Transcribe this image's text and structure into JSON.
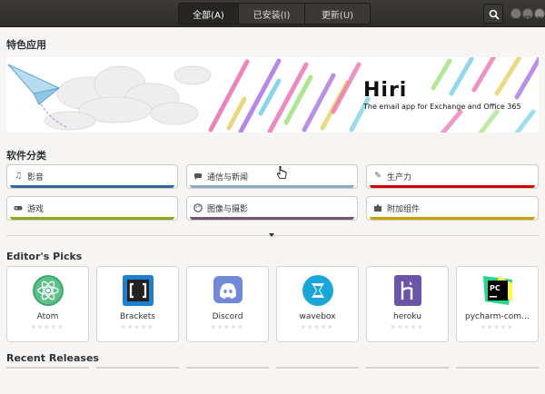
{
  "tabs": [
    {
      "label": "全部(A)",
      "active": true
    },
    {
      "label": "已安装(I)",
      "active": false
    },
    {
      "label": "更新(U)",
      "active": false
    }
  ],
  "featured": {
    "title": "特色应用",
    "app_name": "Hiri",
    "tagline": "The email app for Exchange and Office 365"
  },
  "categories": {
    "title": "软件分类",
    "items": [
      {
        "label": "影音",
        "icon": "music-note-icon",
        "color": "#3465a4"
      },
      {
        "label": "通信与新闻",
        "icon": "chat-bubble-icon",
        "color": "#88aacc"
      },
      {
        "label": "生产力",
        "icon": "pencil-icon",
        "color": "#cc0000"
      },
      {
        "label": "游戏",
        "icon": "gamepad-icon",
        "color": "#8ca419"
      },
      {
        "label": "图像与摄影",
        "icon": "palette-icon",
        "color": "#75507b"
      },
      {
        "label": "附加组件",
        "icon": "puzzle-icon",
        "color": "#c4a000"
      }
    ]
  },
  "picks": {
    "title": "Editor's Picks",
    "apps": [
      {
        "name": "Atom",
        "icon": "atom-icon"
      },
      {
        "name": "Brackets",
        "icon": "brackets-icon"
      },
      {
        "name": "Discord",
        "icon": "discord-icon"
      },
      {
        "name": "wavebox",
        "icon": "wavebox-icon"
      },
      {
        "name": "heroku",
        "icon": "heroku-icon"
      },
      {
        "name": "pycharm-com…",
        "icon": "pycharm-icon"
      }
    ]
  },
  "recent": {
    "title": "Recent Releases"
  }
}
